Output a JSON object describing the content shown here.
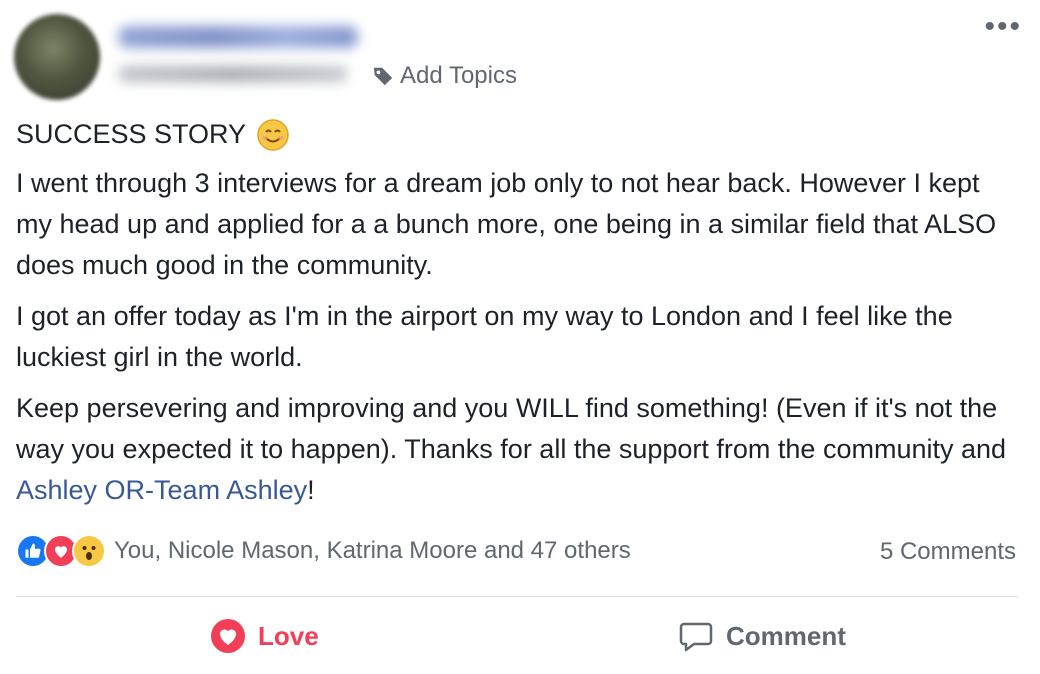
{
  "post": {
    "add_topics_label": "Add Topics",
    "more_label": "•••",
    "title": "SUCCESS STORY",
    "title_emoji": "smiling-face-emoji",
    "paragraph1": "I went through 3 interviews for a dream job only to not hear back. However I kept my head up and applied for a a bunch more, one being in a similar field that ALSO does much good in the community.",
    "paragraph2": "I got an offer today as I'm in the airport on my way to London and I feel like the luckiest girl in the world.",
    "paragraph3_start": "Keep persevering and improving and you WILL find something! (Even if it's not the way you expected it to happen). Thanks for all the support from the community and ",
    "paragraph3_mention": "Ashley OR-Team Ashley",
    "paragraph3_end": "!"
  },
  "reactions": {
    "icons": [
      "like-reaction-icon",
      "love-reaction-icon",
      "wow-reaction-icon"
    ],
    "text": "You, Nicole Mason, Katrina Moore and 47 others",
    "comments_count": "5 Comments"
  },
  "actions": {
    "love_label": "Love",
    "comment_label": "Comment"
  },
  "colors": {
    "love": "#f33e58",
    "link": "#385898",
    "like": "#1877f2",
    "secondary_text": "#606770"
  }
}
